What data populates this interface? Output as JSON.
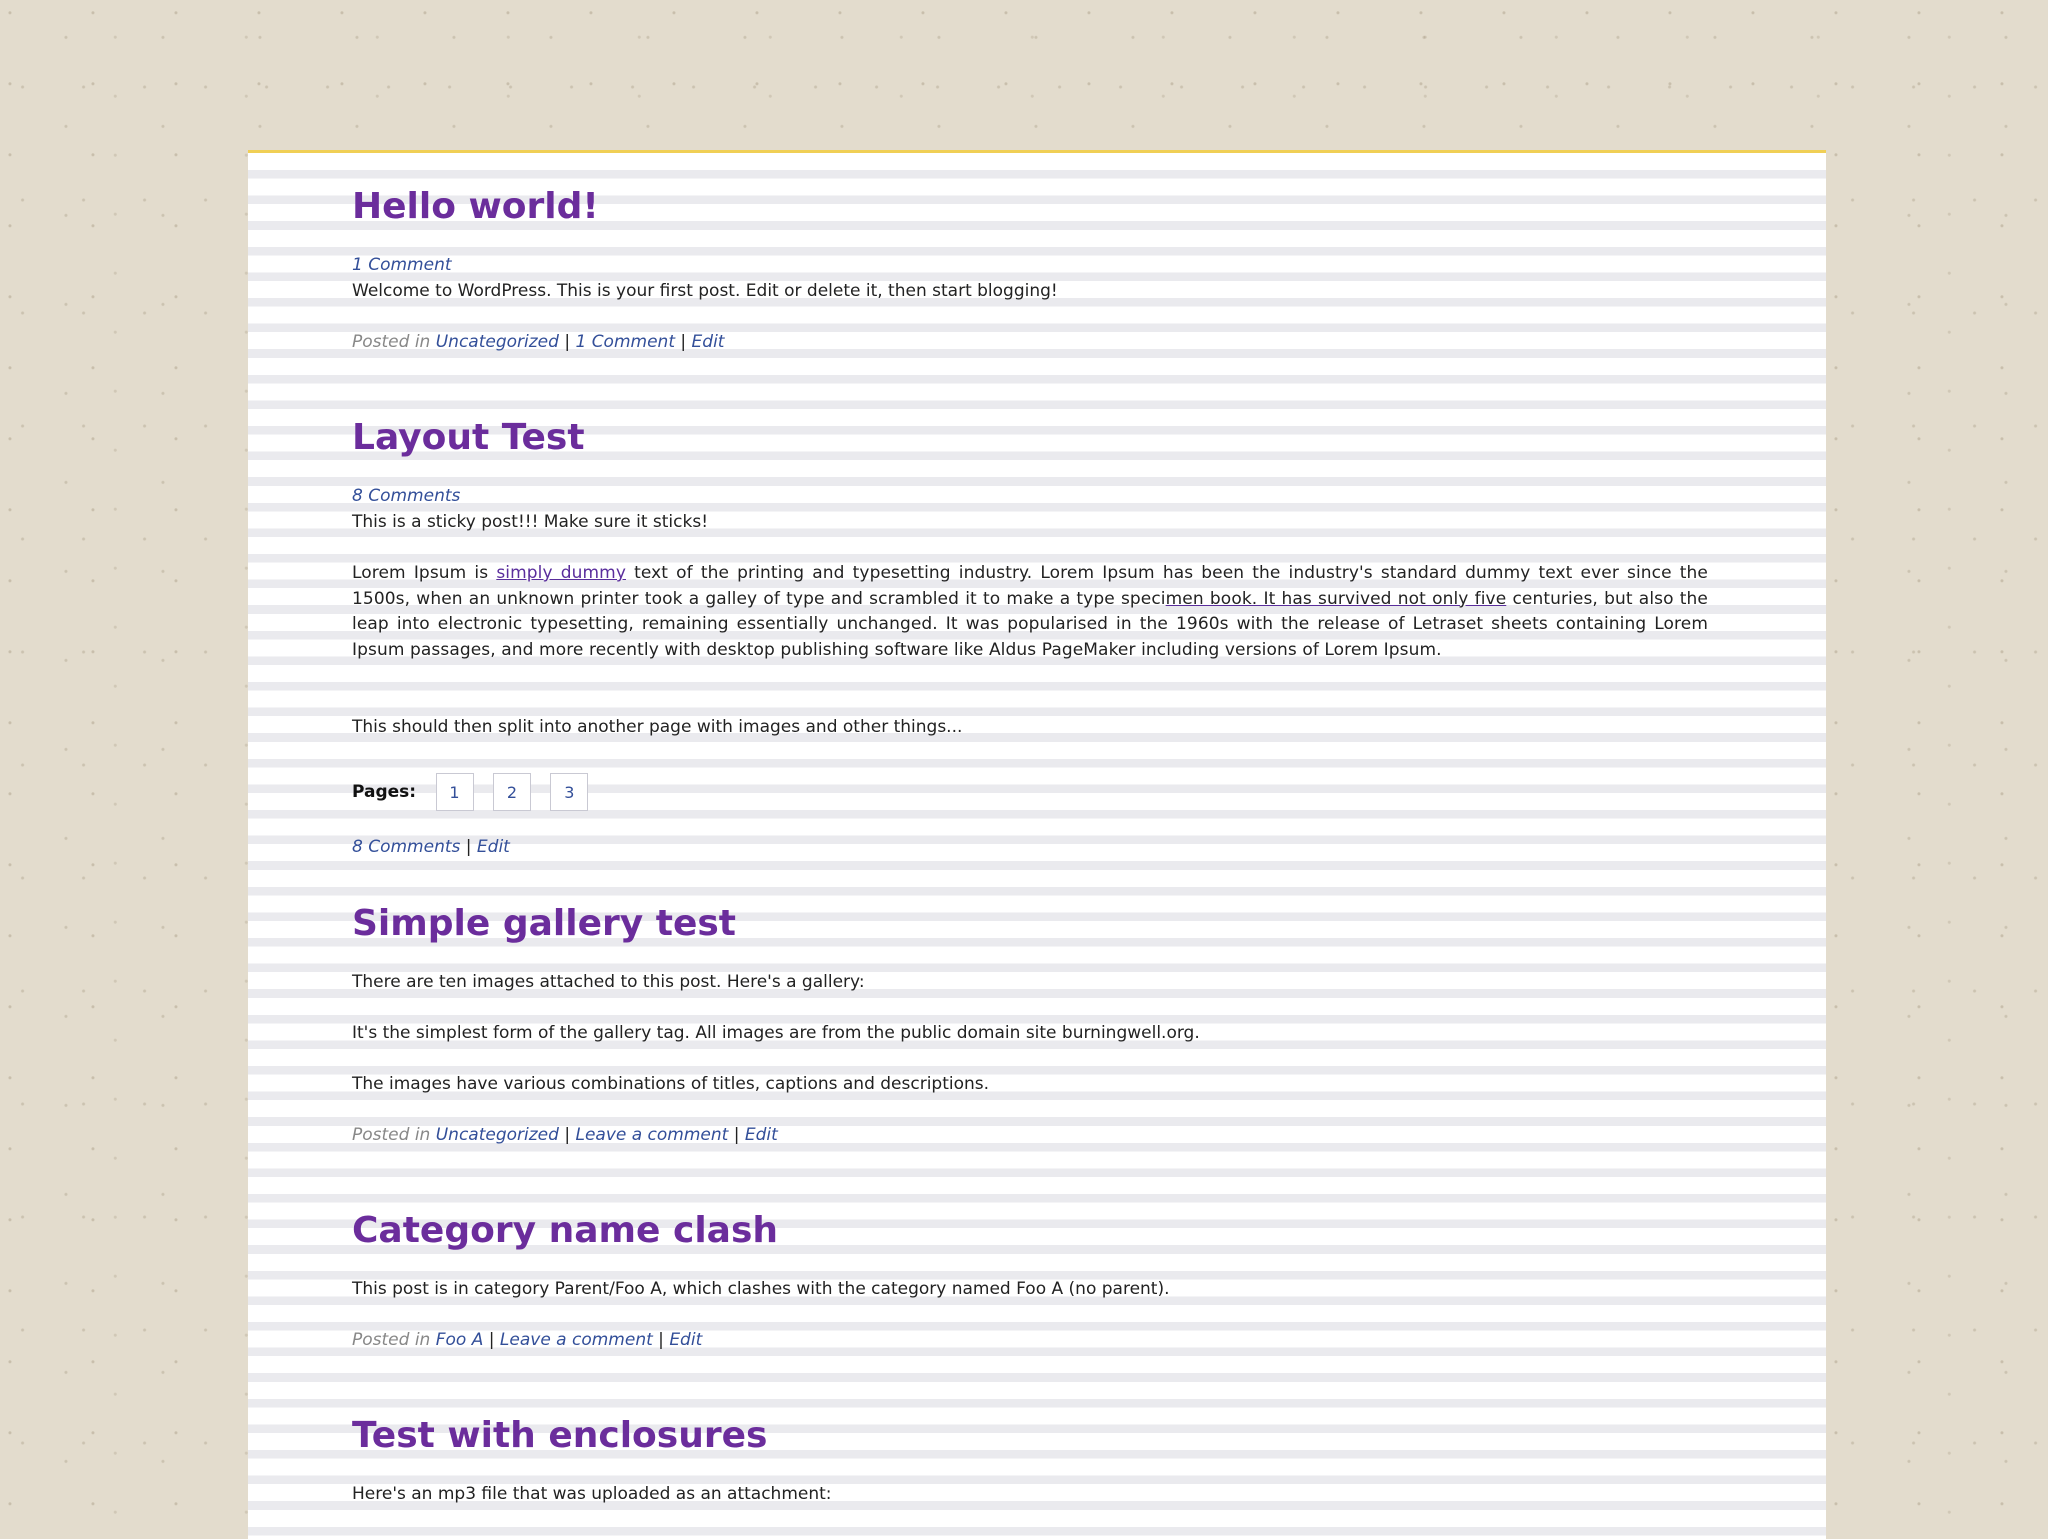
{
  "posts": [
    {
      "title": "Hello world!",
      "comments_link": "1 Comment",
      "body": "Welcome to WordPress. This is your first post. Edit or delete it, then start blogging!",
      "footer": {
        "posted_in": "Posted in",
        "category": "Uncategorized",
        "comments": "1 Comment",
        "edit": "Edit"
      }
    },
    {
      "title": "Layout Test",
      "comments_link": "8 Comments",
      "sticky_text": "This is a sticky post!!! Make sure it sticks!",
      "lorem": {
        "before_link": "Lorem Ipsum is ",
        "link_text": "simply dummy",
        "middle": " text of the printing and typesetting industry. Lorem Ipsum has been the industry's standard dummy text ever since the 1500s, when an unknown printer took a galley of type and scrambled it to make a type speci",
        "underlined": "men book. It has survived not only five",
        "after": " centuries, but also the leap into electronic typesetting, remaining essentially unchanged. It was popularised in the 1960s with the release of Letraset sheets containing Lorem Ipsum passages, and more recently with desktop publishing software like Aldus PageMaker including versions of Lorem Ipsum."
      },
      "split_text": "This should then split into another page with images and other things...",
      "pages_label": "Pages:",
      "pages": [
        "1",
        "2",
        "3"
      ],
      "footer": {
        "comments": "8 Comments",
        "edit": "Edit"
      }
    },
    {
      "title": "Simple gallery test",
      "paragraphs": [
        "There are ten images attached to this post. Here's a gallery:",
        "It's the simplest form of the gallery tag. All images are from the public domain site burningwell.org.",
        "The images have various combinations of titles, captions and descriptions."
      ],
      "footer": {
        "posted_in": "Posted in",
        "category": "Uncategorized",
        "comments": "Leave a comment",
        "edit": "Edit"
      }
    },
    {
      "title": "Category name clash",
      "body": "This post is in category Parent/Foo A, which clashes with the category named Foo A (no parent).",
      "footer": {
        "posted_in": "Posted in",
        "category": "Foo A",
        "comments": "Leave a comment",
        "edit": "Edit"
      }
    },
    {
      "title": "Test with enclosures",
      "body": "Here's an mp3 file that was uploaded as an attachment:"
    }
  ],
  "colors": {
    "title": "#6b2d9c",
    "link": "#334f99",
    "accent_border": "#f0cf55",
    "background": "#e3dccd"
  }
}
